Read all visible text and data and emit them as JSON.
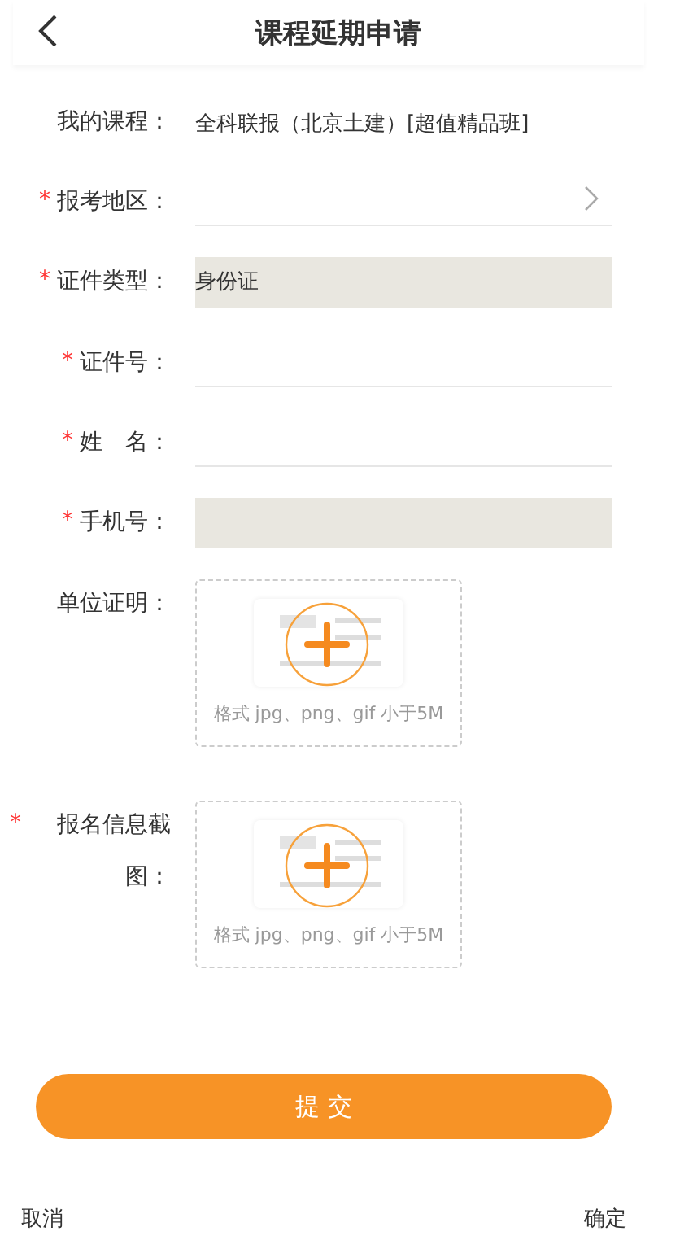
{
  "header": {
    "title": "课程延期申请"
  },
  "fields": [
    {
      "label": "我的课程：",
      "required": false,
      "kind": "text",
      "value": "全科联报（北京土建）[超值精品班]"
    },
    {
      "label": "报考地区：",
      "required": true,
      "kind": "select"
    },
    {
      "label": "证件类型：",
      "required": true,
      "kind": "readonly",
      "value": "身份证"
    },
    {
      "label": "证件号：",
      "required": true,
      "kind": "input"
    },
    {
      "label": "姓　名：",
      "required": true,
      "kind": "input"
    },
    {
      "label": "手机号：",
      "required": true,
      "kind": "readonly"
    },
    {
      "label": "单位证明：",
      "required": false,
      "kind": "upload",
      "hint": "格式 jpg、png、gif 小于5M"
    },
    {
      "label": "报名信息截图：",
      "required": true,
      "kind": "upload",
      "hint": "格式 jpg、png、gif 小于5M"
    }
  ],
  "required_mark": "*",
  "submit": "提 交",
  "footer": {
    "cancel": "取消",
    "confirm": "确定"
  }
}
